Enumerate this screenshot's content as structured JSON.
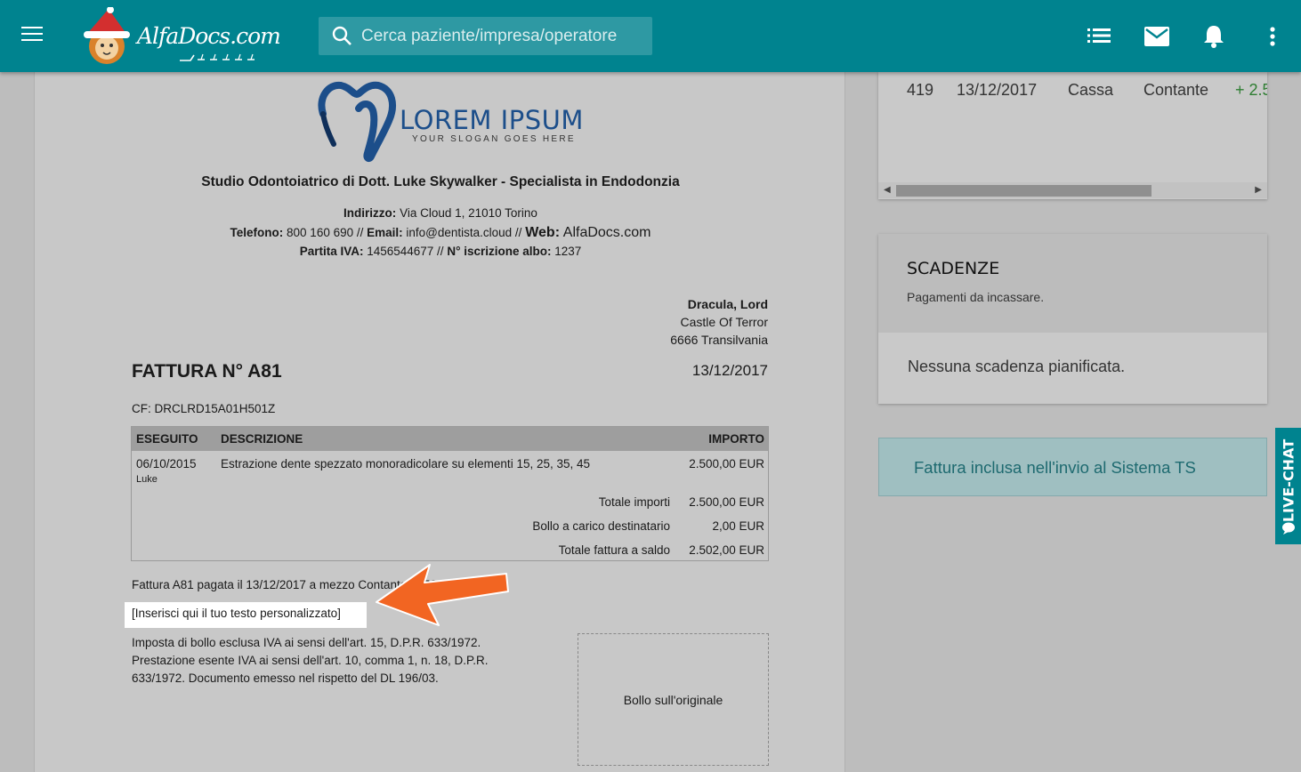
{
  "app": {
    "brand": "AlfaDocs.com",
    "search_placeholder": "Cerca paziente/impresa/operatore"
  },
  "invoice": {
    "logo_name": "LOREM IPSUM",
    "logo_slogan": "YOUR SLOGAN GOES HERE",
    "studio": "Studio Odontoiatrico di Dott. Luke Skywalker - Specialista in Endodonzia",
    "address_label": "Indirizzo:",
    "address": "Via Cloud 1, 21010 Torino",
    "phone_label": "Telefono:",
    "phone": "800 160 690 //",
    "email_label": "Email:",
    "email": "info@dentista.cloud //",
    "web_label": "Web:",
    "web": "AlfaDocs.com",
    "vat_label": "Partita IVA:",
    "vat": "1456544677 //",
    "albo_label": "N° iscrizione albo:",
    "albo": "1237",
    "recipient": {
      "name": "Dracula, Lord",
      "line1": "Castle Of Terror",
      "line2": "6666 Transilvania"
    },
    "title": "FATTURA N° A81",
    "date": "13/12/2017",
    "cf": "CF: DRCLRD15A01H501Z",
    "table": {
      "headers": {
        "done": "ESEGUITO",
        "description": "DESCRIZIONE",
        "amount": "IMPORTO"
      },
      "row": {
        "date": "06/10/2015",
        "operator": "Luke",
        "description": "Estrazione dente spezzato monoradicolare su elementi 15, 25, 35, 45",
        "amount": "2.500,00 EUR"
      },
      "totals": [
        {
          "label": "Totale importi",
          "value": "2.500,00 EUR"
        },
        {
          "label": "Bollo a carico destinatario",
          "value": "2,00 EUR"
        },
        {
          "label": "Totale fattura a saldo",
          "value": "2.502,00 EUR"
        }
      ]
    },
    "paid_line": "Fattura A81 pagata il 13/12/2017 a mezzo Contante: 2.502,00 EUR",
    "custom_text": "[Inserisci qui il tuo testo personalizzato]",
    "legal_1": "Imposta di bollo esclusa IVA ai sensi dell'art. 15, D.P.R. 633/1972.",
    "legal_2": "Prestazione esente IVA ai sensi dell'art. 10, comma 1, n. 18, D.P.R. 633/1972. Documento emesso nel rispetto del DL 196/03.",
    "bollo": "Bollo sull'originale"
  },
  "payments": {
    "row": {
      "id": "419",
      "date": "13/12/2017",
      "account": "Cassa",
      "method": "Contante",
      "amount": "+ 2.5"
    }
  },
  "scadenze": {
    "title": "SCADENZE",
    "subtitle": "Pagamenti da incassare.",
    "empty": "Nessuna scadenza pianificata."
  },
  "ts_notice": "Fattura inclusa nell'invio al Sistema TS",
  "livechat": "LIVE-CHAT",
  "colors": {
    "topbar": "#00838f",
    "arrow": "#f26522",
    "logo_blue": "#1c4e8a"
  }
}
